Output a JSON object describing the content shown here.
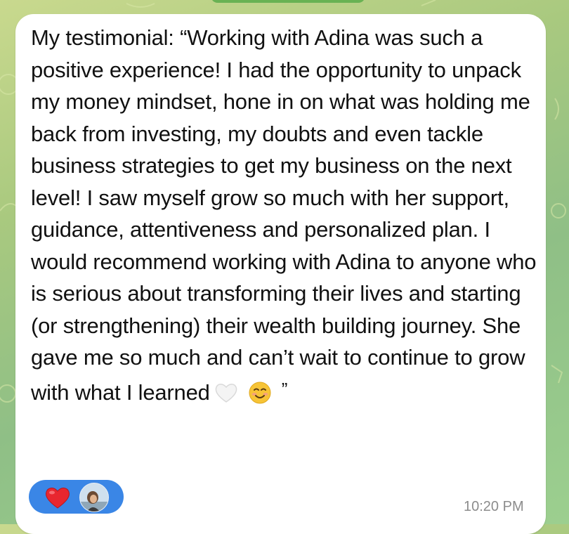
{
  "message": {
    "text": "My testimonial: “Working with Adina was such a positive experience! I had the opportunity to unpack my money mindset, hone in on what was holding me back from investing, my doubts and even tackle business strategies to get my business on the next level! I saw myself grow so much with her support, guidance, attentiveness and personalized plan. I would recommend working with Adina to anyone who is serious about transforming their lives and starting (or strengthening) their wealth building journey. She gave me so much and can’t wait to continue to grow with what I learned",
    "closing_quote": "”",
    "emojis": [
      "white-heart-icon",
      "smiling-face-icon"
    ],
    "timestamp": "10:20 PM"
  },
  "reactions": {
    "emoji": "heart-icon",
    "reactor": "avatar"
  },
  "colors": {
    "bubble": "#ffffff",
    "reaction_pill": "#3a86e6",
    "timestamp": "#8c8c8c",
    "wallpaper": "#a9c97f"
  }
}
